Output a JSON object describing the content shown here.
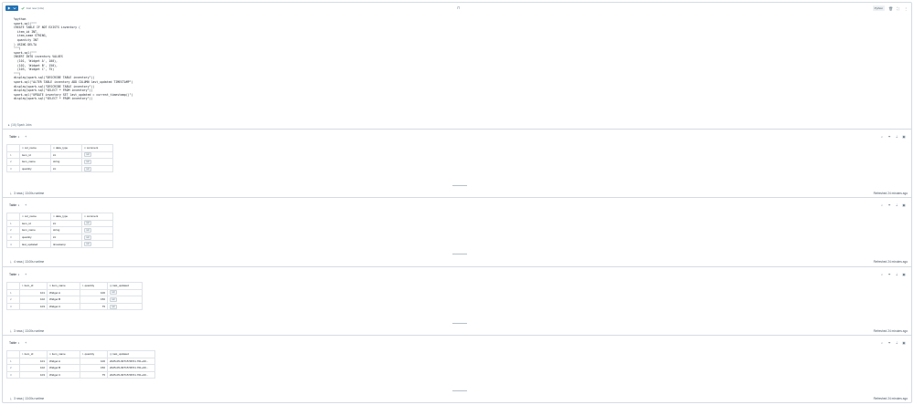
{
  "toolbar": {
    "status": "Just now (14s)",
    "center_glyph": "⊓",
    "language": "Python",
    "colors": {
      "run": "#2272b4",
      "success": "#3ba55c"
    }
  },
  "code_lines": [
    "%python",
    "spark.sql(\"\"\"",
    "CREATE TABLE IF NOT EXISTS inventory (",
    "  item_id INT,",
    "  item_name STRING,",
    "  quantity INT",
    ") USING DELTA",
    "\"\"\")",
    "spark.sql(\"\"\"",
    "INSERT INTO inventory VALUES",
    "  (101, 'Widget A', 100),",
    "  (102, 'Widget B', 150),",
    "  (103, 'Widget C', 75)",
    "\"\"\")",
    "display(spark.sql(\"DESCRIBE TABLE inventory\"))",
    "spark.sql(\"ALTER TABLE inventory ADD COLUMN last_updated TIMESTAMP\")",
    "display(spark.sql(\"DESCRIBE TABLE inventory\"))",
    "display(spark.sql(\"SELECT * FROM inventory\"))",
    "spark.sql(\"UPDATE inventory SET last_updated = current_timestamp()\")",
    "display(spark.sql(\"SELECT * FROM inventory\"))"
  ],
  "spark_jobs": "(16) Spark Jobs",
  "results": [
    {
      "tab": "Table",
      "columns": [
        {
          "type": "A",
          "name": "col_name"
        },
        {
          "type": "A",
          "name": "data_type"
        },
        {
          "type": "A",
          "name": "comment"
        }
      ],
      "rows": [
        [
          "1",
          "item_id",
          "int",
          "null"
        ],
        [
          "2",
          "item_name",
          "string",
          "null"
        ],
        [
          "3",
          "quantity",
          "int",
          "null"
        ]
      ],
      "footer": "3 rows  |  13.00s runtime",
      "refreshed": "Refreshed 24 minutes ago"
    },
    {
      "tab": "Table",
      "columns": [
        {
          "type": "A",
          "name": "col_name"
        },
        {
          "type": "A",
          "name": "data_type"
        },
        {
          "type": "A",
          "name": "comment"
        }
      ],
      "rows": [
        [
          "1",
          "item_id",
          "int",
          "null"
        ],
        [
          "2",
          "item_name",
          "string",
          "null"
        ],
        [
          "3",
          "quantity",
          "int",
          "null"
        ],
        [
          "4",
          "last_updated",
          "timestamp",
          "null"
        ]
      ],
      "footer": "4 rows  |  13.00s runtime",
      "refreshed": "Refreshed 24 minutes ago"
    },
    {
      "tab": "Table",
      "columns": [
        {
          "type": "1",
          "name": "item_id"
        },
        {
          "type": "A",
          "name": "item_name"
        },
        {
          "type": "1",
          "name": "quantity"
        },
        {
          "type": "▤",
          "name": "last_updated"
        }
      ],
      "rows": [
        [
          "1",
          "101",
          "Widget A",
          "100",
          "null"
        ],
        [
          "2",
          "102",
          "Widget B",
          "150",
          "null"
        ],
        [
          "3",
          "103",
          "Widget C",
          "75",
          "null"
        ]
      ],
      "footer": "3 rows  |  13.00s runtime",
      "refreshed": "Refreshed 24 minutes ago"
    },
    {
      "tab": "Table",
      "columns": [
        {
          "type": "1",
          "name": "item_id"
        },
        {
          "type": "A",
          "name": "item_name"
        },
        {
          "type": "1",
          "name": "quantity"
        },
        {
          "type": "▤",
          "name": "last_updated"
        }
      ],
      "rows": [
        [
          "1",
          "101",
          "Widget A",
          "100",
          "2025-05-09T15:58:51.761+00..."
        ],
        [
          "2",
          "102",
          "Widget B",
          "150",
          "2025-05-09T15:58:51.761+00..."
        ],
        [
          "3",
          "103",
          "Widget C",
          "75",
          "2025-05-09T15:58:51.761+00..."
        ]
      ],
      "footer": "3 rows  |  13.00s runtime",
      "refreshed": "Refreshed 24 minutes ago"
    }
  ]
}
